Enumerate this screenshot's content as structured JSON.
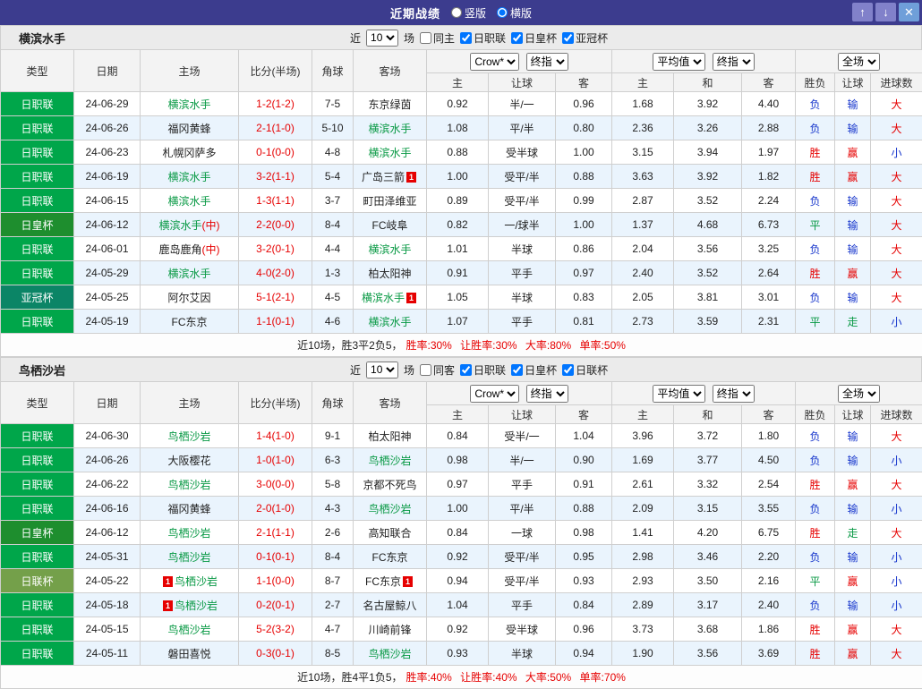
{
  "titlebar": {
    "title": "近期战绩",
    "layout_options": [
      {
        "label": "竖版",
        "selected": false
      },
      {
        "label": "横版",
        "selected": true
      }
    ],
    "buttons": [
      {
        "name": "up",
        "glyph": "↑"
      },
      {
        "name": "down",
        "glyph": "↓"
      },
      {
        "name": "close",
        "glyph": "✕"
      }
    ]
  },
  "league_colors": {
    "日职联": "#00a64a",
    "日皇杯": "#1e8e2e",
    "亚冠杯": "#0b8566",
    "日联杯": "#74a04a"
  },
  "result_colors": {
    "win": "#e60000",
    "draw": "#089944",
    "lose": "#1736cc"
  },
  "columns": {
    "type": "类型",
    "date": "日期",
    "home": "主场",
    "score": "比分(半场)",
    "corner": "角球",
    "away": "客场",
    "odds_home": "主",
    "odds_handicap": "让球",
    "odds_away": "客",
    "avg_home": "主",
    "avg_draw": "和",
    "avg_away": "客",
    "res_wdl": "胜负",
    "res_handicap": "让球",
    "res_goals": "进球数"
  },
  "sections": [
    {
      "team": "横滨水手",
      "filter": {
        "near": "近",
        "count": "10",
        "games": "场",
        "same": "同主",
        "same_checked": false,
        "leagues": [
          {
            "label": "日职联",
            "checked": true
          },
          {
            "label": "日皇杯",
            "checked": true
          },
          {
            "label": "亚冠杯",
            "checked": true
          }
        ]
      },
      "selects": {
        "bookmaker": "Crow*",
        "odds_kind": "终指",
        "average": "平均值",
        "avg_kind": "终指",
        "scope": "全场"
      },
      "rows": [
        {
          "league": "日职联",
          "date": "24-06-29",
          "home": {
            "name": "横滨水手",
            "focus": true
          },
          "score": "1-2(1-2)",
          "corner": "7-5",
          "away": {
            "name": "东京绿茵"
          },
          "odds": [
            "0.92",
            "半/一",
            "0.96"
          ],
          "avg": [
            "1.68",
            "3.92",
            "4.40"
          ],
          "results": [
            "负",
            "输",
            "大"
          ]
        },
        {
          "league": "日职联",
          "date": "24-06-26",
          "home": {
            "name": "福冈黄蜂"
          },
          "score": "2-1(1-0)",
          "corner": "5-10",
          "away": {
            "name": "横滨水手",
            "focus": true
          },
          "odds": [
            "1.08",
            "平/半",
            "0.80"
          ],
          "avg": [
            "2.36",
            "3.26",
            "2.88"
          ],
          "results": [
            "负",
            "输",
            "大"
          ]
        },
        {
          "league": "日职联",
          "date": "24-06-23",
          "home": {
            "name": "札幌冈萨多"
          },
          "score": "0-1(0-0)",
          "corner": "4-8",
          "away": {
            "name": "横滨水手",
            "focus": true
          },
          "odds": [
            "0.88",
            "受半球",
            "1.00"
          ],
          "avg": [
            "3.15",
            "3.94",
            "1.97"
          ],
          "results": [
            "胜",
            "赢",
            "小"
          ]
        },
        {
          "league": "日职联",
          "date": "24-06-19",
          "home": {
            "name": "横滨水手",
            "focus": true
          },
          "score": "3-2(1-1)",
          "corner": "5-4",
          "away": {
            "name": "广岛三箭",
            "badge": "1"
          },
          "odds": [
            "1.00",
            "受平/半",
            "0.88"
          ],
          "avg": [
            "3.63",
            "3.92",
            "1.82"
          ],
          "results": [
            "胜",
            "赢",
            "大"
          ]
        },
        {
          "league": "日职联",
          "date": "24-06-15",
          "home": {
            "name": "横滨水手",
            "focus": true
          },
          "score": "1-3(1-1)",
          "corner": "3-7",
          "away": {
            "name": "町田泽维亚"
          },
          "odds": [
            "0.89",
            "受平/半",
            "0.99"
          ],
          "avg": [
            "2.87",
            "3.52",
            "2.24"
          ],
          "results": [
            "负",
            "输",
            "大"
          ]
        },
        {
          "league": "日皇杯",
          "date": "24-06-12",
          "home": {
            "name": "横滨水手",
            "focus": true,
            "suffix": "(中)"
          },
          "score": "2-2(0-0)",
          "corner": "8-4",
          "away": {
            "name": "FC岐阜"
          },
          "odds": [
            "0.82",
            "一/球半",
            "1.00"
          ],
          "avg": [
            "1.37",
            "4.68",
            "6.73"
          ],
          "results": [
            "平",
            "输",
            "大"
          ]
        },
        {
          "league": "日职联",
          "date": "24-06-01",
          "home": {
            "name": "鹿岛鹿角",
            "suffix": "(中)"
          },
          "score": "3-2(0-1)",
          "corner": "4-4",
          "away": {
            "name": "横滨水手",
            "focus": true
          },
          "odds": [
            "1.01",
            "半球",
            "0.86"
          ],
          "avg": [
            "2.04",
            "3.56",
            "3.25"
          ],
          "results": [
            "负",
            "输",
            "大"
          ]
        },
        {
          "league": "日职联",
          "date": "24-05-29",
          "home": {
            "name": "横滨水手",
            "focus": true
          },
          "score": "4-0(2-0)",
          "corner": "1-3",
          "away": {
            "name": "柏太阳神"
          },
          "odds": [
            "0.91",
            "平手",
            "0.97"
          ],
          "avg": [
            "2.40",
            "3.52",
            "2.64"
          ],
          "results": [
            "胜",
            "赢",
            "大"
          ]
        },
        {
          "league": "亚冠杯",
          "date": "24-05-25",
          "home": {
            "name": "阿尔艾因"
          },
          "score": "5-1(2-1)",
          "corner": "4-5",
          "away": {
            "name": "横滨水手",
            "focus": true,
            "badge": "1"
          },
          "odds": [
            "1.05",
            "半球",
            "0.83"
          ],
          "avg": [
            "2.05",
            "3.81",
            "3.01"
          ],
          "results": [
            "负",
            "输",
            "大"
          ]
        },
        {
          "league": "日职联",
          "date": "24-05-19",
          "home": {
            "name": "FC东京"
          },
          "score": "1-1(0-1)",
          "corner": "4-6",
          "away": {
            "name": "横滨水手",
            "focus": true
          },
          "odds": [
            "1.07",
            "平手",
            "0.81"
          ],
          "avg": [
            "2.73",
            "3.59",
            "2.31"
          ],
          "results": [
            "平",
            "走",
            "小"
          ]
        }
      ],
      "summary": {
        "prefix": "近10场，胜3平2负5，",
        "stats": "胜率:30% 让胜率:30% 大率:80% 单率:50%"
      }
    },
    {
      "team": "鸟栖沙岩",
      "filter": {
        "near": "近",
        "count": "10",
        "games": "场",
        "same": "同客",
        "same_checked": false,
        "leagues": [
          {
            "label": "日职联",
            "checked": true
          },
          {
            "label": "日皇杯",
            "checked": true
          },
          {
            "label": "日联杯",
            "checked": true
          }
        ]
      },
      "selects": {
        "bookmaker": "Crow*",
        "odds_kind": "终指",
        "average": "平均值",
        "avg_kind": "终指",
        "scope": "全场"
      },
      "rows": [
        {
          "league": "日职联",
          "date": "24-06-30",
          "home": {
            "name": "鸟栖沙岩",
            "focus": true
          },
          "score": "1-4(1-0)",
          "corner": "9-1",
          "away": {
            "name": "柏太阳神"
          },
          "odds": [
            "0.84",
            "受半/一",
            "1.04"
          ],
          "avg": [
            "3.96",
            "3.72",
            "1.80"
          ],
          "results": [
            "负",
            "输",
            "大"
          ]
        },
        {
          "league": "日职联",
          "date": "24-06-26",
          "home": {
            "name": "大阪樱花"
          },
          "score": "1-0(1-0)",
          "corner": "6-3",
          "away": {
            "name": "鸟栖沙岩",
            "focus": true
          },
          "odds": [
            "0.98",
            "半/一",
            "0.90"
          ],
          "avg": [
            "1.69",
            "3.77",
            "4.50"
          ],
          "results": [
            "负",
            "输",
            "小"
          ]
        },
        {
          "league": "日职联",
          "date": "24-06-22",
          "home": {
            "name": "鸟栖沙岩",
            "focus": true
          },
          "score": "3-0(0-0)",
          "corner": "5-8",
          "away": {
            "name": "京都不死鸟"
          },
          "odds": [
            "0.97",
            "平手",
            "0.91"
          ],
          "avg": [
            "2.61",
            "3.32",
            "2.54"
          ],
          "results": [
            "胜",
            "赢",
            "大"
          ]
        },
        {
          "league": "日职联",
          "date": "24-06-16",
          "home": {
            "name": "福冈黄蜂"
          },
          "score": "2-0(1-0)",
          "corner": "4-3",
          "away": {
            "name": "鸟栖沙岩",
            "focus": true
          },
          "odds": [
            "1.00",
            "平/半",
            "0.88"
          ],
          "avg": [
            "2.09",
            "3.15",
            "3.55"
          ],
          "results": [
            "负",
            "输",
            "小"
          ]
        },
        {
          "league": "日皇杯",
          "date": "24-06-12",
          "home": {
            "name": "鸟栖沙岩",
            "focus": true
          },
          "score": "2-1(1-1)",
          "corner": "2-6",
          "away": {
            "name": "高知联合"
          },
          "odds": [
            "0.84",
            "一球",
            "0.98"
          ],
          "avg": [
            "1.41",
            "4.20",
            "6.75"
          ],
          "results": [
            "胜",
            "走",
            "大"
          ]
        },
        {
          "league": "日职联",
          "date": "24-05-31",
          "home": {
            "name": "鸟栖沙岩",
            "focus": true
          },
          "score": "0-1(0-1)",
          "corner": "8-4",
          "away": {
            "name": "FC东京"
          },
          "odds": [
            "0.92",
            "受平/半",
            "0.95"
          ],
          "avg": [
            "2.98",
            "3.46",
            "2.20"
          ],
          "results": [
            "负",
            "输",
            "小"
          ]
        },
        {
          "league": "日联杯",
          "date": "24-05-22",
          "home": {
            "name": "鸟栖沙岩",
            "focus": true,
            "badge": "1",
            "badge_pos": "before"
          },
          "score": "1-1(0-0)",
          "corner": "8-7",
          "away": {
            "name": "FC东京",
            "badge": "1"
          },
          "odds": [
            "0.94",
            "受平/半",
            "0.93"
          ],
          "avg": [
            "2.93",
            "3.50",
            "2.16"
          ],
          "results": [
            "平",
            "赢",
            "小"
          ]
        },
        {
          "league": "日职联",
          "date": "24-05-18",
          "home": {
            "name": "鸟栖沙岩",
            "focus": true,
            "badge": "1",
            "badge_pos": "before"
          },
          "score": "0-2(0-1)",
          "corner": "2-7",
          "away": {
            "name": "名古屋鲸八"
          },
          "odds": [
            "1.04",
            "平手",
            "0.84"
          ],
          "avg": [
            "2.89",
            "3.17",
            "2.40"
          ],
          "results": [
            "负",
            "输",
            "小"
          ]
        },
        {
          "league": "日职联",
          "date": "24-05-15",
          "home": {
            "name": "鸟栖沙岩",
            "focus": true
          },
          "score": "5-2(3-2)",
          "corner": "4-7",
          "away": {
            "name": "川崎前锋"
          },
          "odds": [
            "0.92",
            "受半球",
            "0.96"
          ],
          "avg": [
            "3.73",
            "3.68",
            "1.86"
          ],
          "results": [
            "胜",
            "赢",
            "大"
          ]
        },
        {
          "league": "日职联",
          "date": "24-05-11",
          "home": {
            "name": "磐田喜悦"
          },
          "score": "0-3(0-1)",
          "corner": "8-5",
          "away": {
            "name": "鸟栖沙岩",
            "focus": true
          },
          "odds": [
            "0.93",
            "半球",
            "0.94"
          ],
          "avg": [
            "1.90",
            "3.56",
            "3.69"
          ],
          "results": [
            "胜",
            "赢",
            "大"
          ]
        }
      ],
      "summary": {
        "prefix": "近10场，胜4平1负5，",
        "stats": "胜率:40% 让胜率:40% 大率:50% 单率:70%"
      }
    }
  ]
}
